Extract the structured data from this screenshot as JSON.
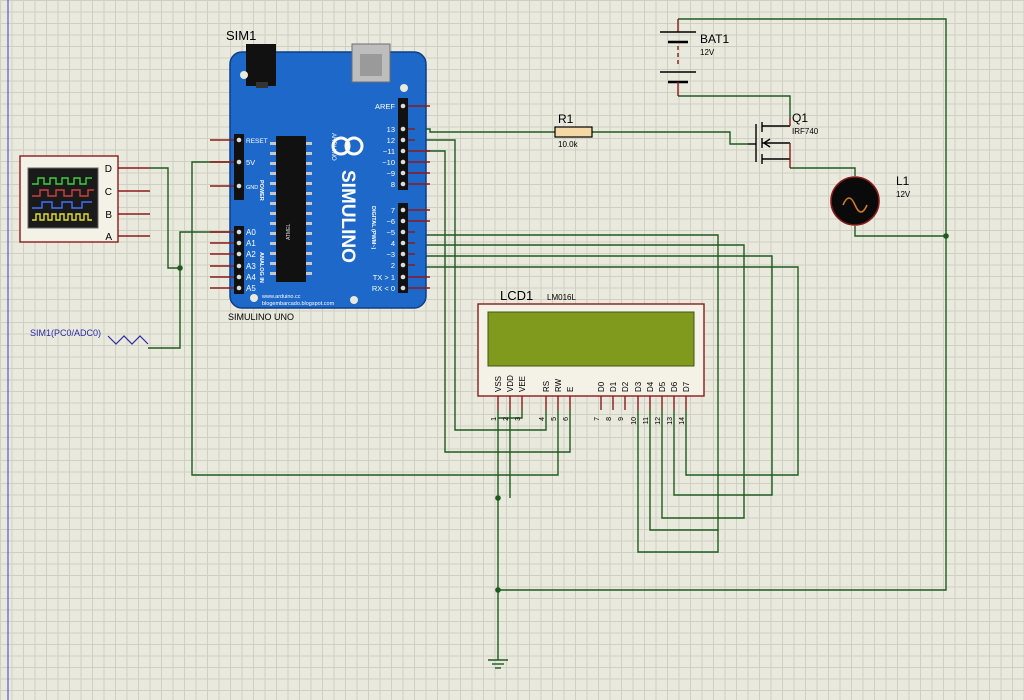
{
  "sim": {
    "ref": "SIM1",
    "board_name": "SIMULINO UNO",
    "brand": "SIMULINO",
    "maker": "ARDUINO",
    "url1": "www.arduino.cc",
    "url2": "blogembarcado.blogspot.com",
    "chip": "ATMEL",
    "section_power": "POWER",
    "section_analog": "ANALOG IN",
    "section_digital": "DIGITAL (PWM~)",
    "power_pins": [
      "RESET",
      "5V",
      "GND"
    ],
    "analog_pins": [
      "A0",
      "A1",
      "A2",
      "A3",
      "A4",
      "A5"
    ],
    "digital_top": [
      "AREF",
      "13",
      "12",
      "~11",
      "~10",
      "~9",
      "8"
    ],
    "digital_bottom": [
      "7",
      "~6",
      "~5",
      "4",
      "~3",
      "2",
      "TX > 1",
      "RX < 0"
    ]
  },
  "scope": {
    "channels": [
      "D",
      "C",
      "B",
      "A"
    ]
  },
  "probe_label": "SIM1(PC0/ADC0)",
  "bat": {
    "ref": "BAT1",
    "value": "12V"
  },
  "r1": {
    "ref": "R1",
    "value": "10.0k"
  },
  "q1": {
    "ref": "Q1",
    "value": "IRF740"
  },
  "l1": {
    "ref": "L1",
    "value": "12V"
  },
  "lcd": {
    "ref": "LCD1",
    "model": "LM016L",
    "pin_names": [
      "VSS",
      "VDD",
      "VEE",
      "RS",
      "RW",
      "E",
      "D0",
      "D1",
      "D2",
      "D3",
      "D4",
      "D5",
      "D6",
      "D7"
    ],
    "pin_numbers": [
      "1",
      "2",
      "3",
      "4",
      "5",
      "6",
      "7",
      "8",
      "9",
      "10",
      "11",
      "12",
      "13",
      "14"
    ]
  },
  "colors": {
    "wire": "#1f5a1f",
    "pin": "#8b1a1a",
    "board": "#1d68c9",
    "lcd_screen": "#7f9a1c",
    "lcd_body": "#f4f1e6",
    "component_border": "#8b1a1a"
  }
}
